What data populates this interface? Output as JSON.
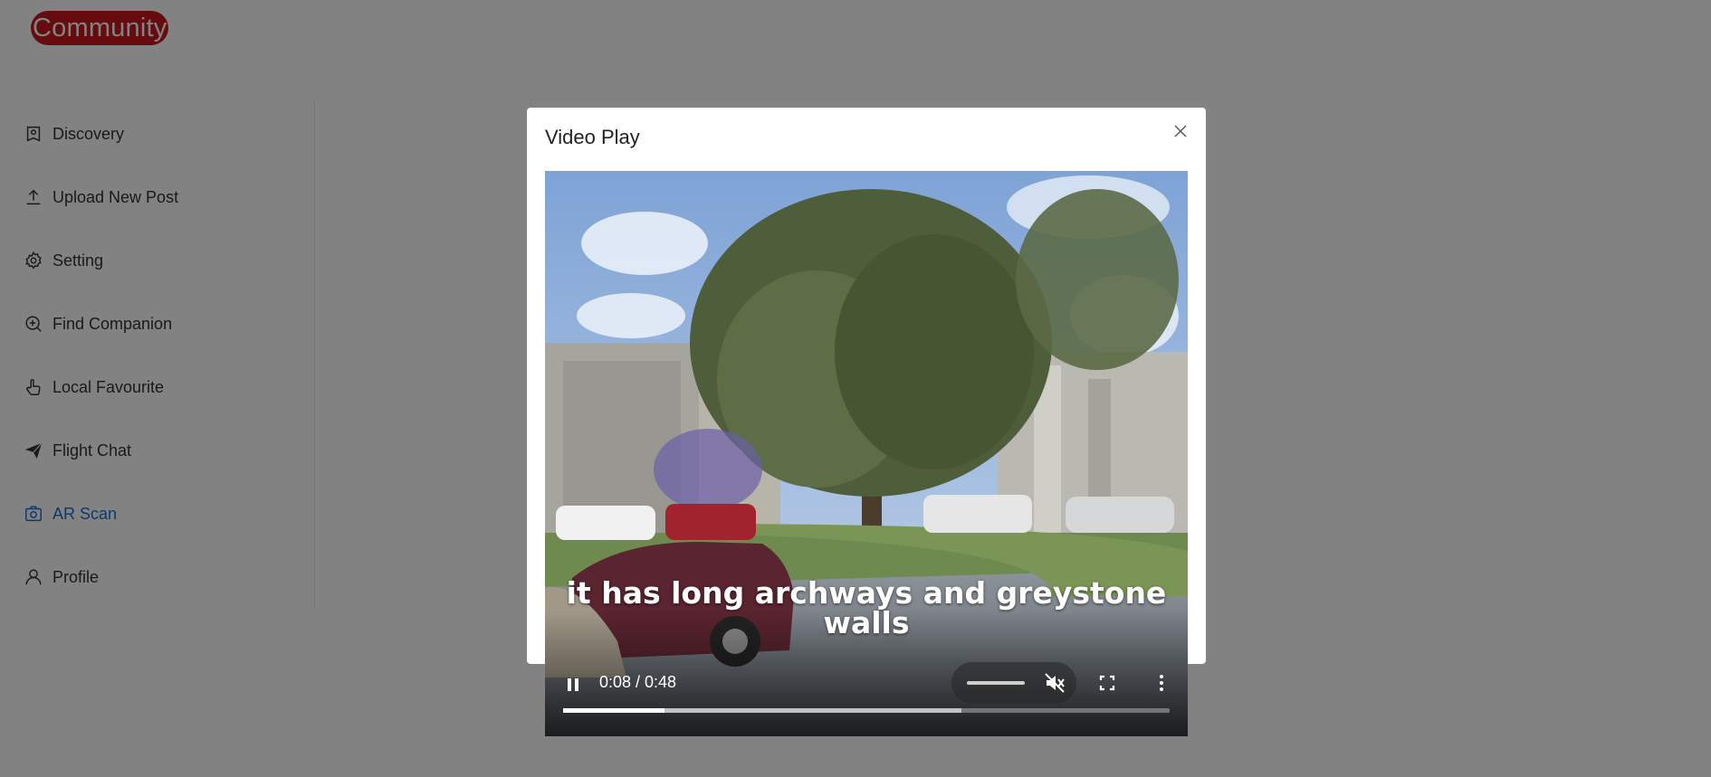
{
  "app": {
    "logo_text": "Community"
  },
  "sidebar": {
    "items": [
      {
        "label": "Discovery",
        "icon": "discovery-icon",
        "active": false
      },
      {
        "label": "Upload New Post",
        "icon": "upload-icon",
        "active": false
      },
      {
        "label": "Setting",
        "icon": "gear-icon",
        "active": false
      },
      {
        "label": "Find Companion",
        "icon": "search-plus-icon",
        "active": false
      },
      {
        "label": "Local Favourite",
        "icon": "hand-pointer-icon",
        "active": false
      },
      {
        "label": "Flight Chat",
        "icon": "send-icon",
        "active": false
      },
      {
        "label": "AR Scan",
        "icon": "camera-icon",
        "active": true
      },
      {
        "label": "Profile",
        "icon": "user-icon",
        "active": false
      }
    ]
  },
  "modal": {
    "title": "Video Play",
    "video": {
      "caption_line1": "it has long archways and greystone",
      "caption_line2": "walls",
      "time": "0:08 / 0:48",
      "muted": true,
      "progress_fraction": 0.1667,
      "buffered_fraction": 0.656
    }
  },
  "colors": {
    "logo_bg": "#c8161d",
    "active_nav": "#1f6fd1",
    "overlay": "rgba(0,0,0,0.49)"
  }
}
